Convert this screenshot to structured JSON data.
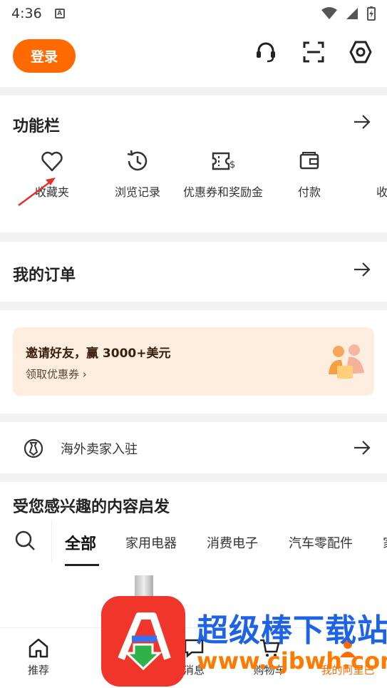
{
  "status_bar": {
    "time": "4:36",
    "notification_icon": "A"
  },
  "header": {
    "login_label": "登录"
  },
  "features": {
    "title": "功能栏",
    "items": [
      {
        "label": "收藏夹",
        "icon": "heart-icon"
      },
      {
        "label": "浏览记录",
        "icon": "history-icon"
      },
      {
        "label": "优惠券和奖励金",
        "icon": "coupon-icon"
      },
      {
        "label": "付款",
        "icon": "wallet-icon"
      },
      {
        "label": "收货",
        "icon": "delivery-icon"
      }
    ]
  },
  "orders": {
    "title": "我的订单"
  },
  "invite": {
    "title": "邀请好友，赢 3000+美元",
    "subtitle": "领取优惠券 ›"
  },
  "seller": {
    "label": "海外卖家入驻"
  },
  "interests": {
    "title": "受您感兴趣的内容启发",
    "tabs": [
      "全部",
      "家用电器",
      "消费电子",
      "汽车零配件",
      "家"
    ]
  },
  "bottom_nav": [
    {
      "label": "推荐"
    },
    {
      "label": "消息"
    },
    {
      "label": "购物车"
    },
    {
      "label": "我的阿里巴"
    }
  ],
  "watermark": {
    "name": "超级棒下载站",
    "url": "www.cjbwh.com"
  },
  "colors": {
    "accent": "#ff6a00",
    "invite_bg": "#fdeedf"
  }
}
